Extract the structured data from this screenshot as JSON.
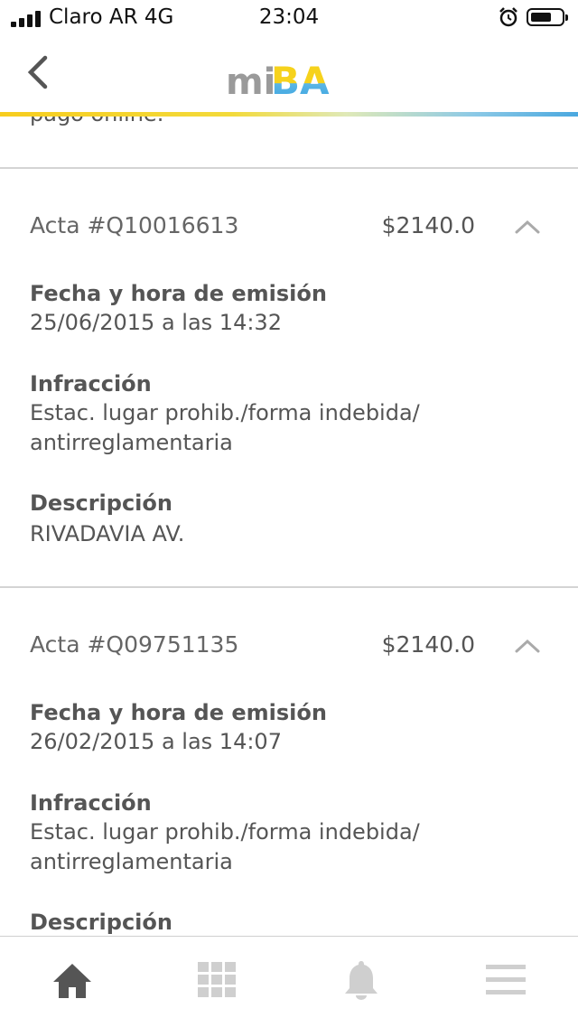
{
  "status_bar": {
    "carrier": "Claro AR 4G",
    "time": "23:04"
  },
  "header": {
    "logo_text_mi": "mi",
    "logo_text_ba": "BA"
  },
  "partial_text": "pago online.",
  "actas": [
    {
      "number": "Acta #Q10016613",
      "amount": "$2140.0",
      "fecha_label": "Fecha y hora de emisión",
      "fecha_value": "25/06/2015 a las 14:32",
      "infraccion_label": "Infracción",
      "infraccion_value": "Estac. lugar prohib./forma indebida/ antirreglamentaria",
      "descripcion_label": "Descripción",
      "descripcion_value": "RIVADAVIA AV."
    },
    {
      "number": "Acta #Q09751135",
      "amount": "$2140.0",
      "fecha_label": "Fecha y hora de emisión",
      "fecha_value": "26/02/2015 a las 14:07",
      "infraccion_label": "Infracción",
      "infraccion_value": "Estac. lugar prohib./forma indebida/ antirreglamentaria",
      "descripcion_label": "Descripción"
    }
  ],
  "colors": {
    "accent_yellow": "#f7cd1e",
    "accent_blue": "#4aa8df",
    "text_gray": "#555555"
  }
}
